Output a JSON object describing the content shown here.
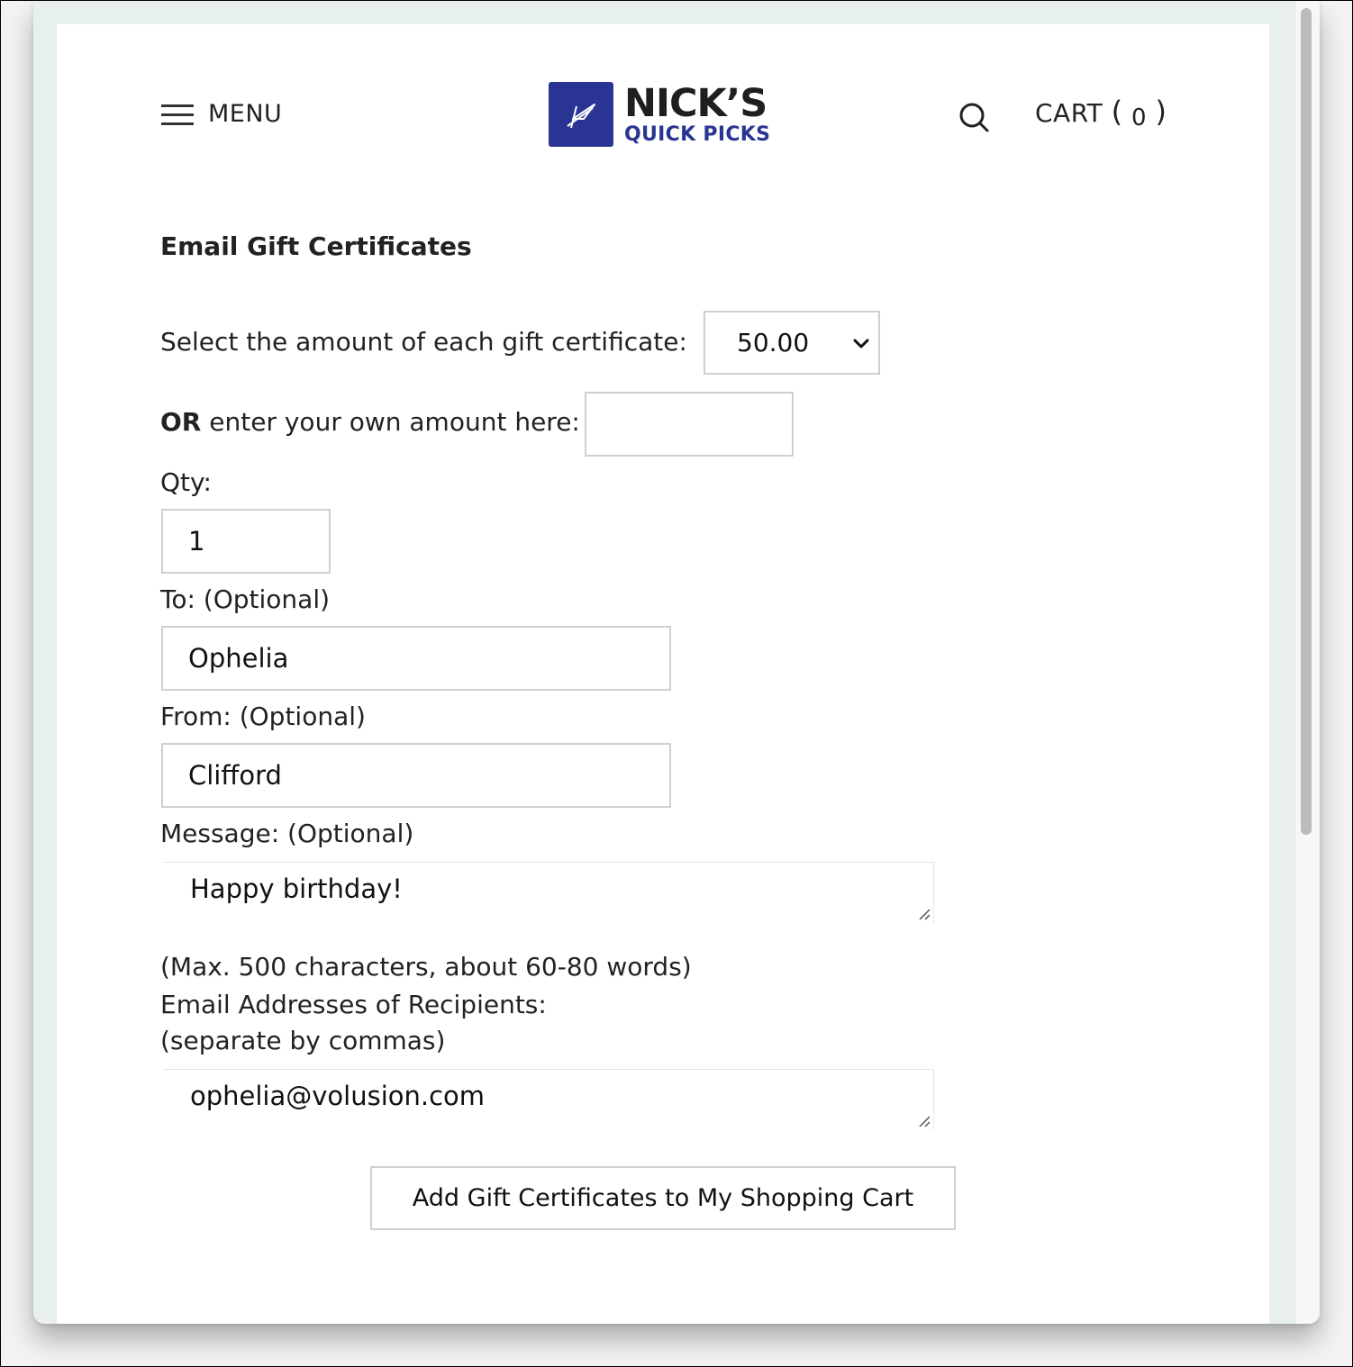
{
  "header": {
    "menu_label": "MENU",
    "logo_line1": "NICK’S",
    "logo_line2": "QUICK PICKS",
    "cart_label": "CART",
    "cart_open": "(",
    "cart_count": "0",
    "cart_close": ")"
  },
  "form": {
    "title": "Email Gift Certificates",
    "amount_label": "Select the amount of each gift certificate:",
    "amount_selected": "50.00",
    "own_amount_or": "OR",
    "own_amount_label": " enter your own amount here:",
    "own_amount_value": "",
    "qty_label": "Qty:",
    "qty_value": "1",
    "to_label": "To: (Optional)",
    "to_value": "Ophelia",
    "from_label": "From: (Optional)",
    "from_value": "Clifford",
    "message_label": "Message: (Optional)",
    "message_value": "Happy birthday!",
    "max_note": "(Max. 500 characters, about 60-80 words)",
    "emails_label": "Email Addresses of Recipients:",
    "emails_note": "(separate by commas)",
    "emails_value": "ophelia@volusion.com",
    "submit_label": "Add Gift Certificates to My Shopping Cart"
  },
  "colors": {
    "brand": "#2a3593",
    "text": "#222222",
    "border": "#cfcfcf"
  }
}
